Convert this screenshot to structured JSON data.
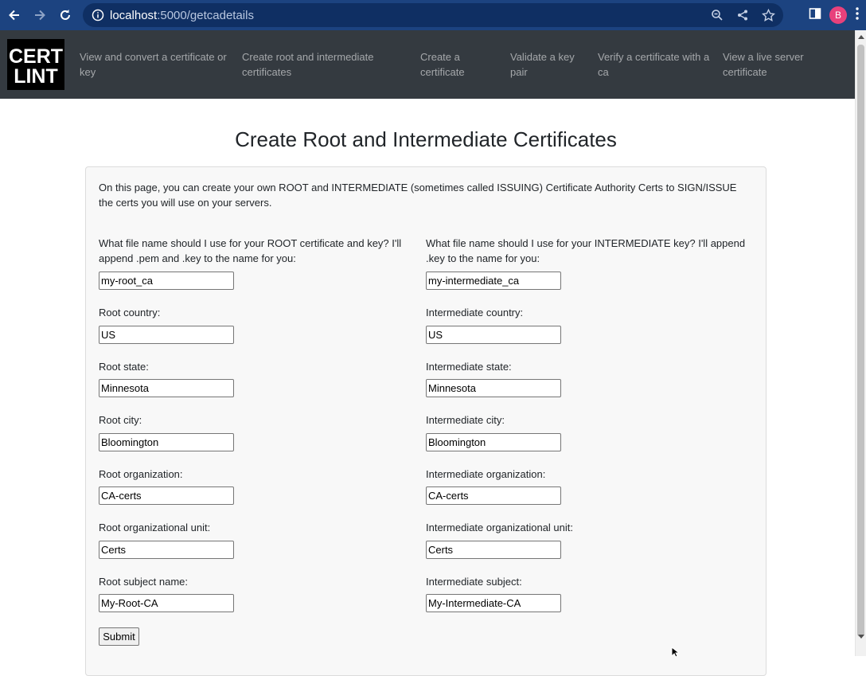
{
  "browser": {
    "url_host": "localhost",
    "url_path": ":5000/getcadetails",
    "profile_initial": "B"
  },
  "navbar": {
    "logo_line1": "CERT",
    "logo_line2": "LINT",
    "links": [
      "View and convert a certificate or key",
      "Create root and intermediate certificates",
      "Create a certificate",
      "Validate a key pair",
      "Verify a certificate with a ca",
      "View a live server certificate"
    ]
  },
  "page": {
    "title": "Create Root and Intermediate Certificates",
    "intro": "On this page, you can create your own ROOT and INTERMEDIATE (sometimes called ISSUING) Certificate Authority Certs to SIGN/ISSUE the certs you will use on your servers."
  },
  "root": {
    "filename_label": "What file name should I use for your ROOT certificate and key? I'll append .pem and .key to the name for you:",
    "filename_value": "my-root_ca",
    "country_label": "Root country:",
    "country_value": "US",
    "state_label": "Root state:",
    "state_value": "Minnesota",
    "city_label": "Root city:",
    "city_value": "Bloomington",
    "org_label": "Root organization:",
    "org_value": "CA-certs",
    "ou_label": "Root organizational unit:",
    "ou_value": "Certs",
    "subject_label": "Root subject name:",
    "subject_value": "My-Root-CA"
  },
  "intermediate": {
    "filename_label": "What file name should I use for your INTERMEDIATE key? I'll append .key to the name for you:",
    "filename_value": "my-intermediate_ca",
    "country_label": "Intermediate country:",
    "country_value": "US",
    "state_label": "Intermediate state:",
    "state_value": "Minnesota",
    "city_label": "Intermediate city:",
    "city_value": "Bloomington",
    "org_label": "Intermediate organization:",
    "org_value": "CA-certs",
    "ou_label": "Intermediate organizational unit:",
    "ou_value": "Certs",
    "subject_label": "Intermediate subject:",
    "subject_value": "My-Intermediate-CA"
  },
  "form": {
    "submit_label": "Submit"
  },
  "colors": {
    "chrome": "#1c4380",
    "navbar": "#343a40",
    "card": "#f8f8f8"
  }
}
